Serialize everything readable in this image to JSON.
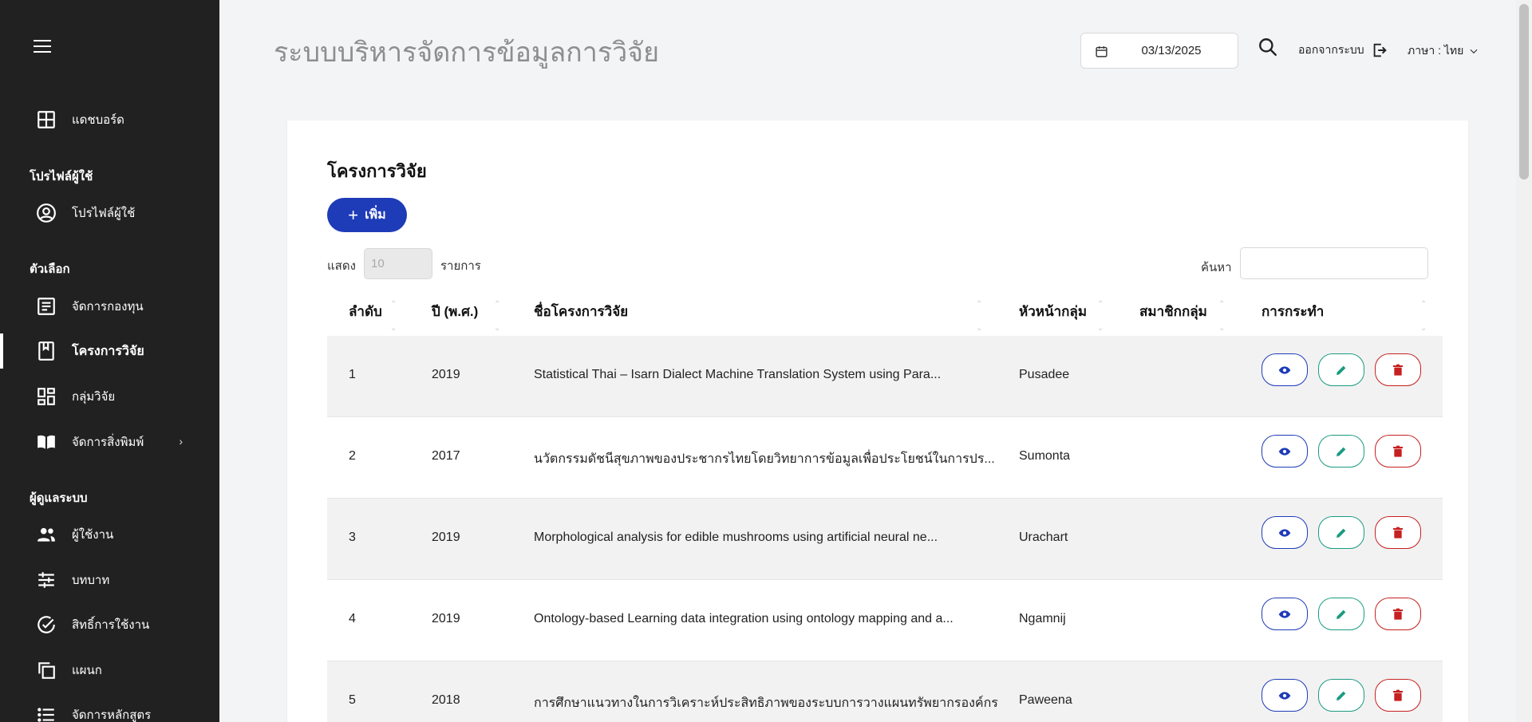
{
  "app": {
    "title": "ระบบบริหารจัดการข้อมูลการวิจัย"
  },
  "header": {
    "date": "03/13/2025",
    "logout_label": "ออกจากระบบ",
    "language_label": "ภาษา : ไทย"
  },
  "sidebar": {
    "dashboard": "แดชบอร์ด",
    "section_profile": "โปรไฟล์ผู้ใช้",
    "profile": "โปรไฟล์ผู้ใช้",
    "section_options": "ตัวเลือก",
    "funds": "จัดการกองทุน",
    "projects": "โครงการวิจัย",
    "groups": "กลุ่มวิจัย",
    "publications": "จัดการสิ่งพิมพ์",
    "section_admin": "ผู้ดูแลระบบ",
    "users": "ผู้ใช้งาน",
    "roles": "บทบาท",
    "permissions": "สิทธิ์การใช้งาน",
    "departments": "แผนก",
    "curriculum": "จัดการหลักสูตร"
  },
  "page": {
    "title": "โครงการวิจัย",
    "add_label": "เพิ่ม",
    "show_label": "แสดง",
    "page_size_placeholder": "10",
    "items_label": "รายการ",
    "search_label": "ค้นหา"
  },
  "table": {
    "columns": {
      "no": "ลำดับ",
      "year": "ปี (พ.ศ.)",
      "name": "ชื่อโครงการวิจัย",
      "leader": "หัวหน้ากลุ่ม",
      "members": "สมาชิกกลุ่ม",
      "actions": "การกระทำ"
    },
    "rows": [
      {
        "no": "1",
        "year": "2019",
        "name": "Statistical Thai – Isarn Dialect Machine Translation System using Para...",
        "leader": "Pusadee",
        "members": ""
      },
      {
        "no": "2",
        "year": "2017",
        "name": "นวัตกรรมดัชนีสุขภาพของประชากรไทยโดยวิทยาการข้อมูลเพื่อประโยชน์ในการปร...",
        "leader": "Sumonta",
        "members": ""
      },
      {
        "no": "3",
        "year": "2019",
        "name": "Morphological analysis for edible mushrooms using artificial neural ne...",
        "leader": "Urachart",
        "members": ""
      },
      {
        "no": "4",
        "year": "2019",
        "name": "Ontology-based Learning data integration using ontology mapping and a...",
        "leader": "Ngamnij",
        "members": ""
      },
      {
        "no": "5",
        "year": "2018",
        "name": "การศึกษาแนวทางในการวิเคราะห์ประสิทธิภาพของระบบการวางแผนทรัพยากรองค์กร",
        "leader": "Paweena",
        "members": ""
      }
    ]
  },
  "colors": {
    "primary": "#1e3bb8",
    "edit": "#1a9b82",
    "delete": "#c62020",
    "sidebar": "#212121"
  }
}
